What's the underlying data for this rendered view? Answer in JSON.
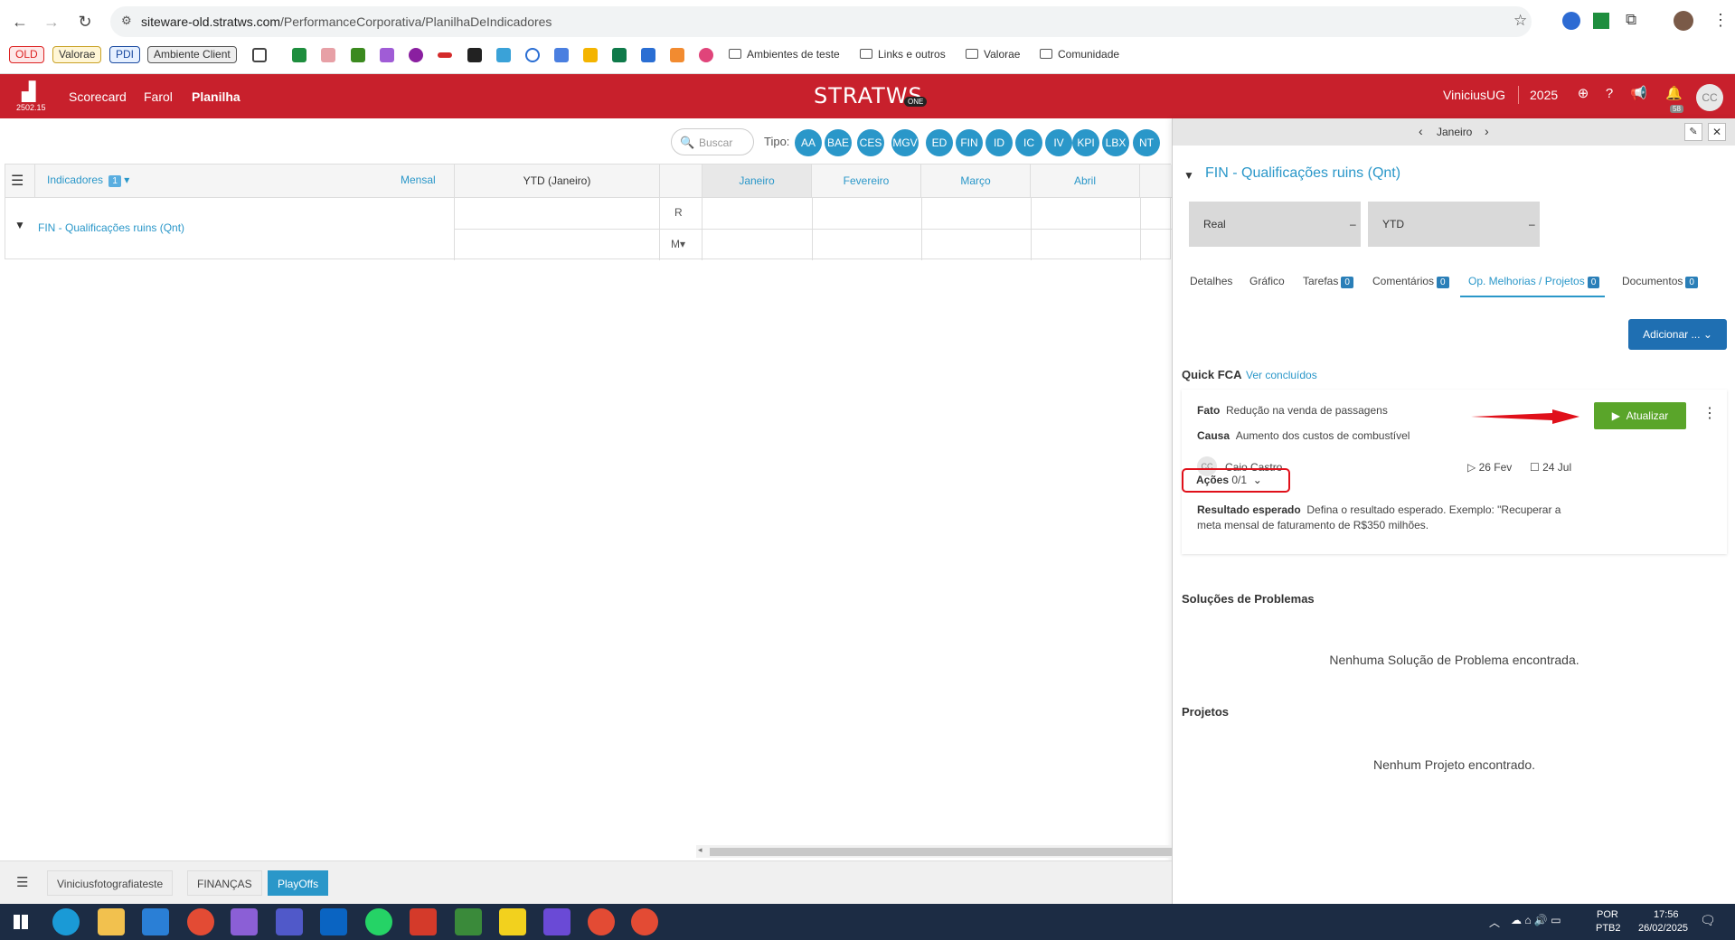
{
  "browser": {
    "url_prefix": "siteware-old.stratws.com",
    "url_path": "/PerformanceCorporativa/PlanilhaDeIndicadores",
    "bookmarks_tags": [
      "OLD",
      "Valorae",
      "PDI",
      "Ambiente Client"
    ],
    "bookmark_folders": [
      "Ambientes de teste",
      "Links e outros",
      "Valorae",
      "Comunidade"
    ]
  },
  "header": {
    "version": "2502.15",
    "nav": [
      "Scorecard",
      "Farol",
      "Planilha"
    ],
    "brand": "STRATWS",
    "brand_sub": "ONE",
    "user": "ViniciusUG",
    "year": "2025",
    "notif_count": "58",
    "avatar": "CC"
  },
  "filter": {
    "search_placeholder": "Buscar",
    "tipo_label": "Tipo:",
    "tipos": [
      "AA",
      "BAE",
      "CES",
      "MGV",
      "ED",
      "FIN",
      "ID",
      "IC",
      "IV",
      "KPI",
      "LBX",
      "NT"
    ]
  },
  "grid": {
    "indicadores_label": "Indicadores",
    "indicadores_count": "1",
    "period": "Mensal",
    "ytd_label": "YTD (Janeiro)",
    "months": [
      "Janeiro",
      "Fevereiro",
      "Março",
      "Abril"
    ],
    "row_label": "FIN - Qualificações ruins (Qnt)",
    "row_r": "R",
    "row_m": "M▾"
  },
  "panel": {
    "month": "Janeiro",
    "title": "FIN - Qualificações ruins (Qnt)",
    "kpis": [
      {
        "label": "Real",
        "value": "–"
      },
      {
        "label": "YTD",
        "value": "–"
      }
    ],
    "tabs": [
      {
        "label": "Detalhes",
        "count": ""
      },
      {
        "label": "Gráfico",
        "count": ""
      },
      {
        "label": "Tarefas",
        "count": "0"
      },
      {
        "label": "Comentários",
        "count": "0"
      },
      {
        "label": "Op. Melhorias / Projetos",
        "count": "0"
      },
      {
        "label": "Documentos",
        "count": "0"
      }
    ],
    "add_button": "Adicionar ...",
    "quick_fca_title": "Quick FCA",
    "ver_concluidos": "Ver concluídos",
    "fca": {
      "fato_label": "Fato",
      "fato": "Redução na venda de passagens",
      "causa_label": "Causa",
      "causa": "Aumento dos custos de combustível",
      "owner_initials": "CC",
      "owner": "Caio Castro",
      "start": "26 Fev",
      "end": "24 Jul",
      "acoes_label": "Ações",
      "acoes_count": "0/1",
      "resultado_label": "Resultado esperado",
      "resultado_line1": "Defina o resultado esperado. Exemplo: \"Recuperar a",
      "resultado_line2": "meta mensal de faturamento de R$350 milhões.",
      "atualizar": "Atualizar"
    },
    "solucoes_title": "Soluções de Problemas",
    "solucoes_empty": "Nenhuma Solução de Problema encontrada.",
    "projetos_title": "Projetos",
    "projetos_empty": "Nenhum Projeto encontrado."
  },
  "bottom_tabs": [
    "Viniciusfotografiateste",
    "FINANÇAS",
    "PlayOffs"
  ],
  "taskbar": {
    "lang1": "POR",
    "lang2": "PTB2",
    "time": "17:56",
    "date": "26/02/2025"
  }
}
